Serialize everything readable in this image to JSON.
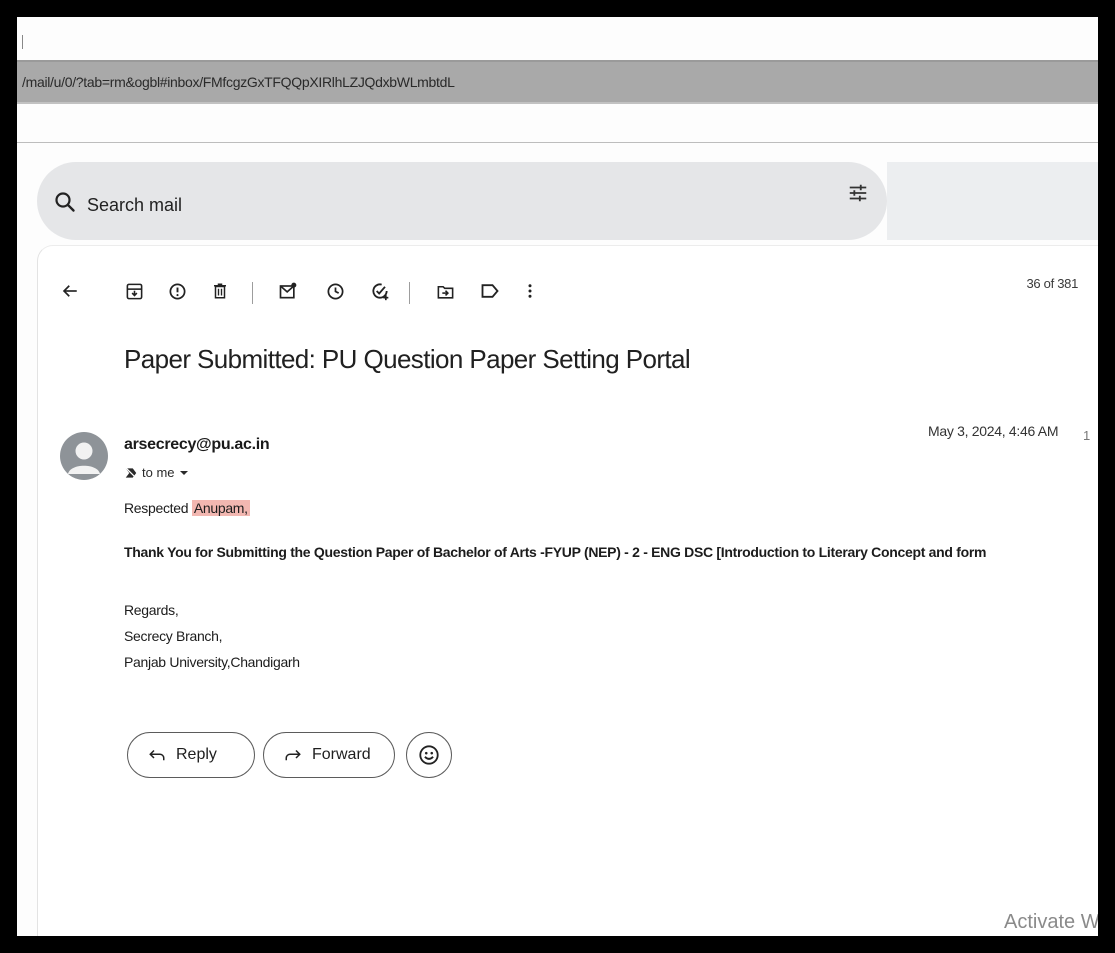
{
  "browser": {
    "url": "/mail/u/0/?tab=rm&ogbl#inbox/FMfcgzGxTFQQpXIRlhLZJQdxbWLmbtdL"
  },
  "search": {
    "placeholder": "Search mail"
  },
  "toolbar": {
    "icons": [
      "back-arrow-icon",
      "archive-icon",
      "report-spam-icon",
      "delete-icon",
      "mark-unread-icon",
      "snooze-icon",
      "add-task-icon",
      "move-to-icon",
      "label-icon",
      "more-options-icon"
    ],
    "counter": "36 of 381"
  },
  "email": {
    "subject": "Paper Submitted: PU Question Paper Setting Portal",
    "sender": "arsecrecy@pu.ac.in",
    "recipient": "to me",
    "date": "May 3, 2024, 4:46 AM",
    "date_extra": "1",
    "greeting_prefix": "Respected",
    "greeting_name": "Anupam,",
    "body_line": "Thank You for Submitting the Question Paper of Bachelor of Arts -FYUP (NEP) - 2 - ENG DSC [Introduction to Literary Concept and form",
    "regards": "Regards,",
    "signature_line1": "Secrecy Branch,",
    "signature_line2": "Panjab University,Chandigarh"
  },
  "actions": {
    "reply": "Reply",
    "forward": "Forward"
  },
  "watermark": {
    "text": "Activate W"
  },
  "colors": {
    "highlight": "#f2b7b1",
    "search_bg": "#e5e6e8"
  }
}
